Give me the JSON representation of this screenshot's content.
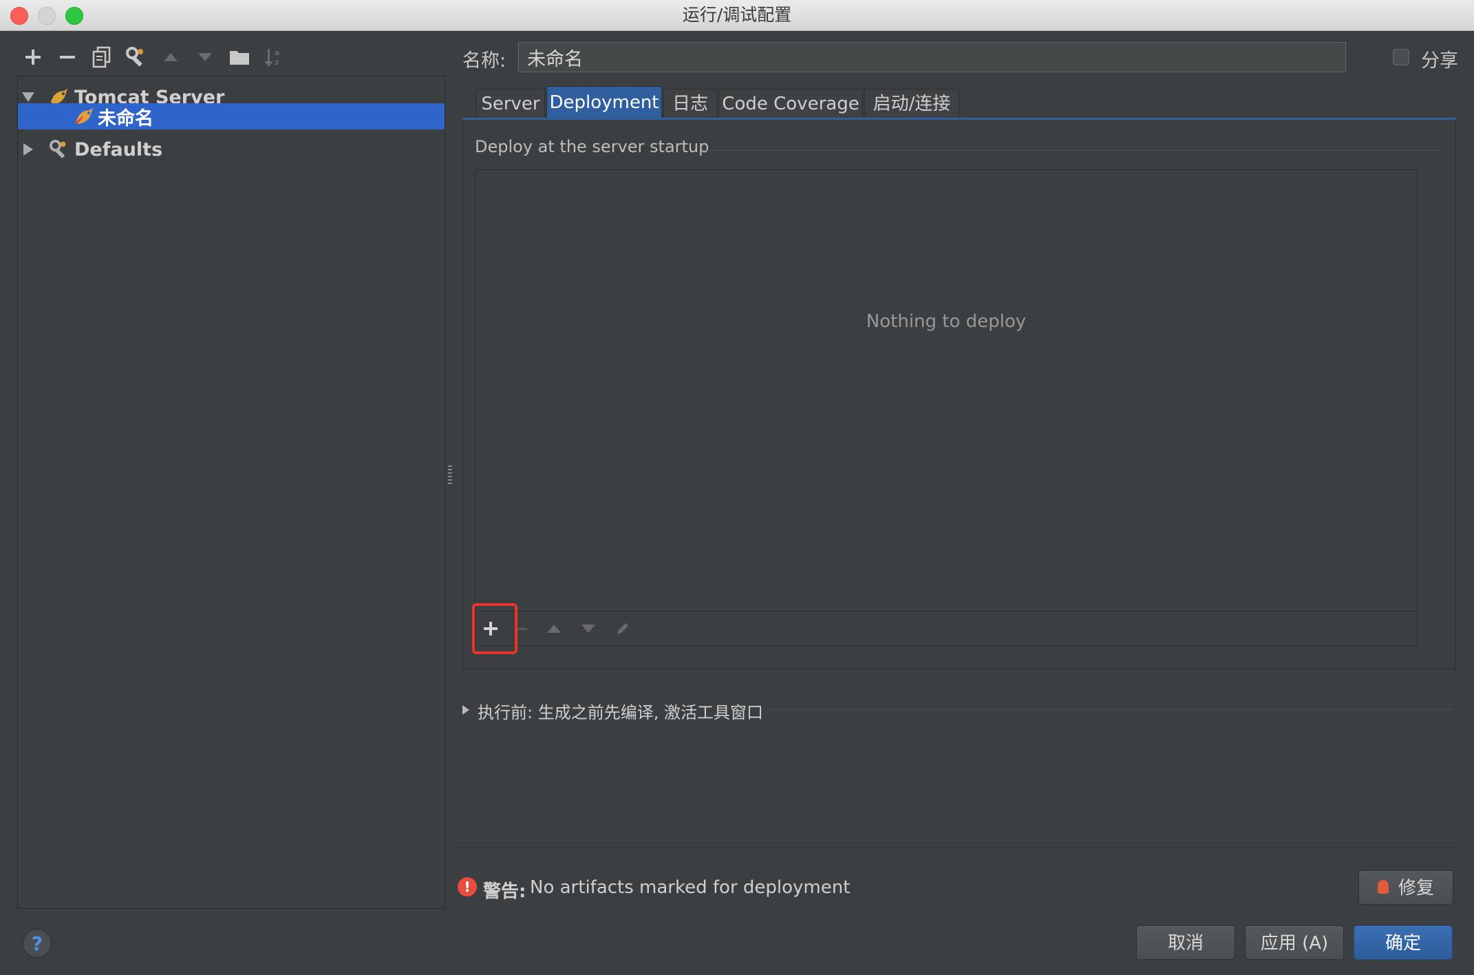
{
  "window": {
    "title": "运行/调试配置"
  },
  "left_toolbar": {
    "icons": [
      "add-icon",
      "remove-icon",
      "copy-icon",
      "wrench-icon",
      "move-up-icon",
      "move-down-icon",
      "folder-icon",
      "sort-icon"
    ]
  },
  "tree": {
    "items": [
      {
        "label": "Tomcat Server",
        "expanded": true
      },
      {
        "label": "未命名",
        "selected": true
      },
      {
        "label": "Defaults",
        "expanded": false
      }
    ]
  },
  "name_field": {
    "label": "名称:",
    "value": "未命名"
  },
  "share": {
    "label": "分享",
    "checked": false
  },
  "tabs": [
    {
      "label": "Server"
    },
    {
      "label": "Deployment",
      "active": true
    },
    {
      "label": "日志"
    },
    {
      "label": "Code Coverage"
    },
    {
      "label": "启动/连接"
    }
  ],
  "deployment": {
    "section_title": "Deploy at the server startup",
    "empty_text": "Nothing to deploy"
  },
  "before_launch": {
    "label": "执行前: 生成之前先编译, 激活工具窗口"
  },
  "warning": {
    "prefix": "警告:",
    "text": "No artifacts marked for deployment",
    "color": "#e84c3d"
  },
  "buttons": {
    "fix": "修复",
    "cancel": "取消",
    "apply": "应用 (A)",
    "ok": "确定"
  },
  "help": {
    "glyph": "?"
  },
  "colors": {
    "selection": "#2f65ca",
    "accent": "#2f5f9e",
    "highlight": "#e8352b"
  }
}
